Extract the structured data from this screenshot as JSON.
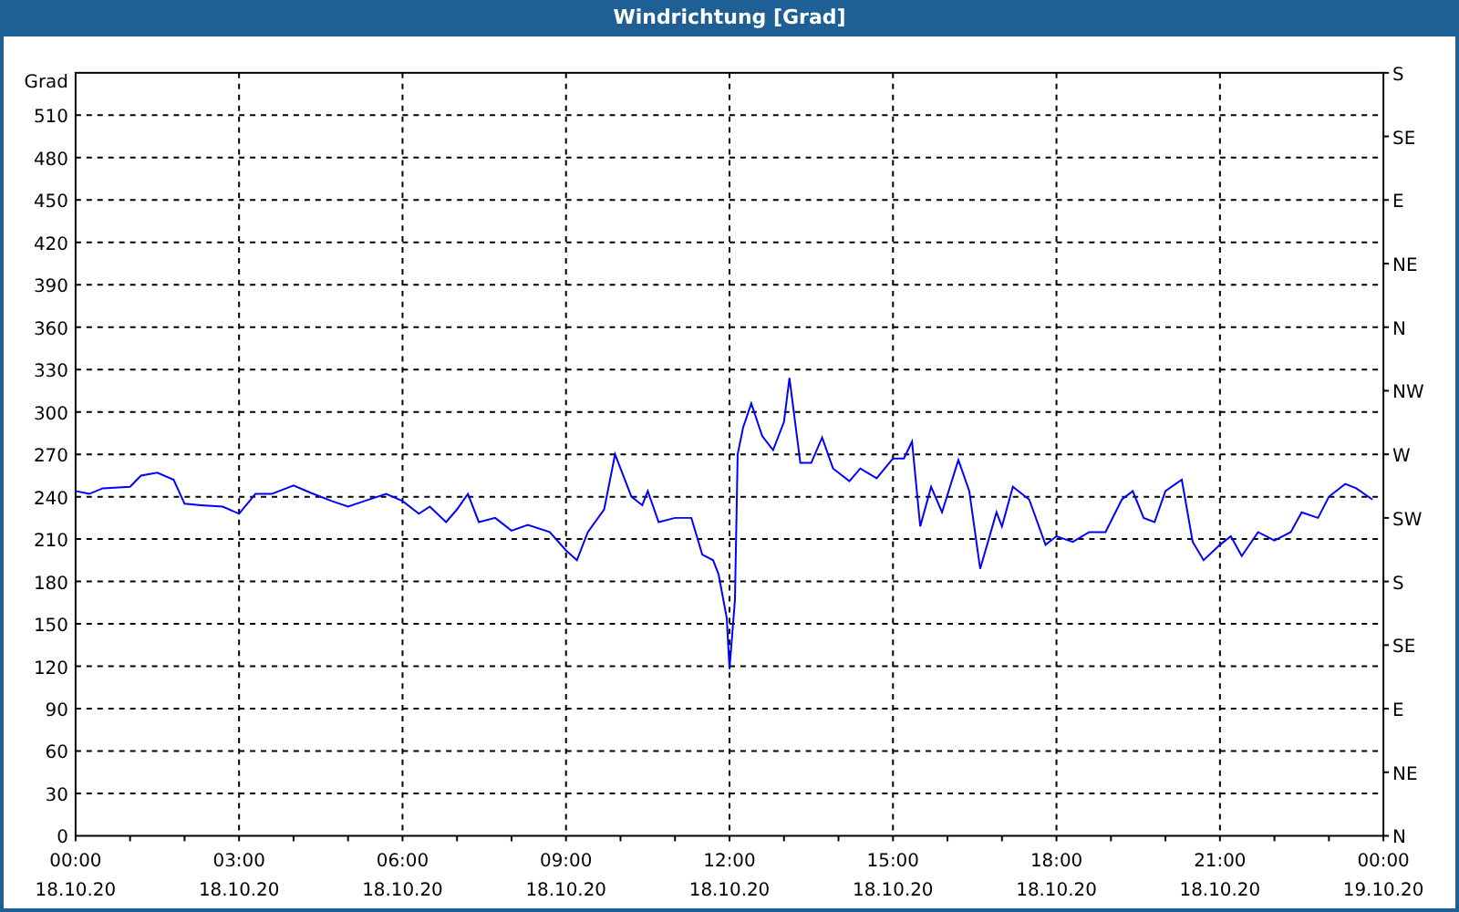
{
  "window": {
    "title": "Windrichtung [Grad]"
  },
  "chart": {
    "right_axis_labels": [
      "S",
      "SE",
      "E",
      "NE",
      "N",
      "NW",
      "W",
      "SW",
      "S",
      "SE",
      "E",
      "NE",
      "N"
    ],
    "x_tick_dates": [
      "18.10.20",
      "18.10.20",
      "18.10.20",
      "18.10.20",
      "18.10.20",
      "18.10.20",
      "18.10.20",
      "18.10.20",
      "19.10.20"
    ],
    "chart_data": {
      "type": "line",
      "grid": true,
      "ylabel": "Grad",
      "xlim": [
        0,
        24
      ],
      "ylim": [
        0,
        540
      ],
      "xticks": [
        {
          "value": 0,
          "label": "00:00"
        },
        {
          "value": 3,
          "label": "03:00"
        },
        {
          "value": 6,
          "label": "06:00"
        },
        {
          "value": 9,
          "label": "09:00"
        },
        {
          "value": 12,
          "label": "12:00"
        },
        {
          "value": 15,
          "label": "15:00"
        },
        {
          "value": 18,
          "label": "18:00"
        },
        {
          "value": 21,
          "label": "21:00"
        },
        {
          "value": 24,
          "label": "00:00"
        }
      ],
      "yticks": [
        0,
        30,
        60,
        90,
        120,
        150,
        180,
        210,
        240,
        270,
        300,
        330,
        360,
        390,
        420,
        450,
        480,
        510
      ],
      "x": [
        0,
        0.25,
        0.5,
        1.0,
        1.2,
        1.5,
        1.8,
        2.0,
        2.3,
        2.7,
        3.0,
        3.3,
        3.6,
        4.0,
        4.3,
        4.7,
        5.0,
        5.3,
        5.7,
        6.0,
        6.3,
        6.5,
        6.8,
        7.0,
        7.2,
        7.4,
        7.7,
        8.0,
        8.3,
        8.7,
        9.0,
        9.2,
        9.4,
        9.7,
        9.9,
        10.0,
        10.2,
        10.4,
        10.5,
        10.7,
        11.0,
        11.3,
        11.5,
        11.7,
        11.8,
        11.95,
        12.0,
        12.1,
        12.15,
        12.25,
        12.4,
        12.6,
        12.8,
        13.0,
        13.1,
        13.3,
        13.5,
        13.7,
        13.9,
        14.2,
        14.4,
        14.7,
        15.0,
        15.2,
        15.35,
        15.5,
        15.7,
        15.9,
        16.2,
        16.4,
        16.6,
        16.9,
        17.0,
        17.2,
        17.5,
        17.8,
        18.0,
        18.3,
        18.6,
        18.9,
        19.2,
        19.4,
        19.6,
        19.8,
        20.0,
        20.3,
        20.5,
        20.7,
        21.0,
        21.2,
        21.4,
        21.7,
        22.0,
        22.3,
        22.5,
        22.8,
        23.0,
        23.3,
        23.5,
        23.8
      ],
      "series": [
        {
          "color": "#0000ff",
          "values": [
            244,
            242,
            246,
            247,
            255,
            257,
            252,
            235,
            234,
            233,
            228,
            242,
            242,
            248,
            243,
            237,
            233,
            237,
            242,
            237,
            228,
            233,
            222,
            231,
            242,
            222,
            225,
            216,
            220,
            215,
            202,
            195,
            215,
            231,
            270,
            260,
            240,
            234,
            244,
            222,
            225,
            225,
            199,
            195,
            185,
            154,
            118,
            167,
            270,
            289,
            306,
            283,
            273,
            293,
            324,
            264,
            264,
            282,
            260,
            251,
            260,
            253,
            267,
            267,
            279,
            219,
            247,
            229,
            266,
            244,
            189,
            229,
            219,
            247,
            238,
            206,
            212,
            208,
            215,
            215,
            238,
            244,
            225,
            222,
            244,
            252,
            208,
            195,
            206,
            212,
            198,
            215,
            209,
            215,
            229,
            225,
            240,
            249,
            246,
            238
          ]
        }
      ]
    }
  }
}
